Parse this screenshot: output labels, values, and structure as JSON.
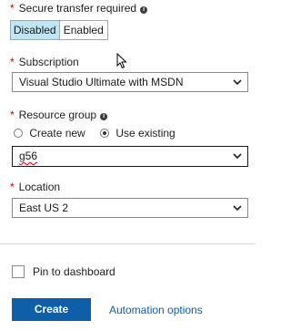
{
  "secure_transfer": {
    "label": "Secure transfer required",
    "options": [
      "Disabled",
      "Enabled"
    ],
    "selected": "Disabled"
  },
  "subscription": {
    "label": "Subscription",
    "value": "Visual Studio Ultimate with MSDN"
  },
  "resource_group": {
    "label": "Resource group",
    "radio_new": "Create new",
    "radio_existing": "Use existing",
    "selected_radio": "Use existing",
    "value": "g56"
  },
  "location": {
    "label": "Location",
    "value": "East US 2"
  },
  "pin_to_dashboard": {
    "label": "Pin to dashboard",
    "checked": false
  },
  "actions": {
    "create_label": "Create",
    "automation_label": "Automation options"
  },
  "colors": {
    "primary_button": "#0e5ea8",
    "toggle_selected": "#bfe6f4",
    "required_asterisk": "#c00000"
  },
  "icons": [
    "info-icon",
    "chevron-down-icon",
    "mouse-cursor-icon"
  ]
}
